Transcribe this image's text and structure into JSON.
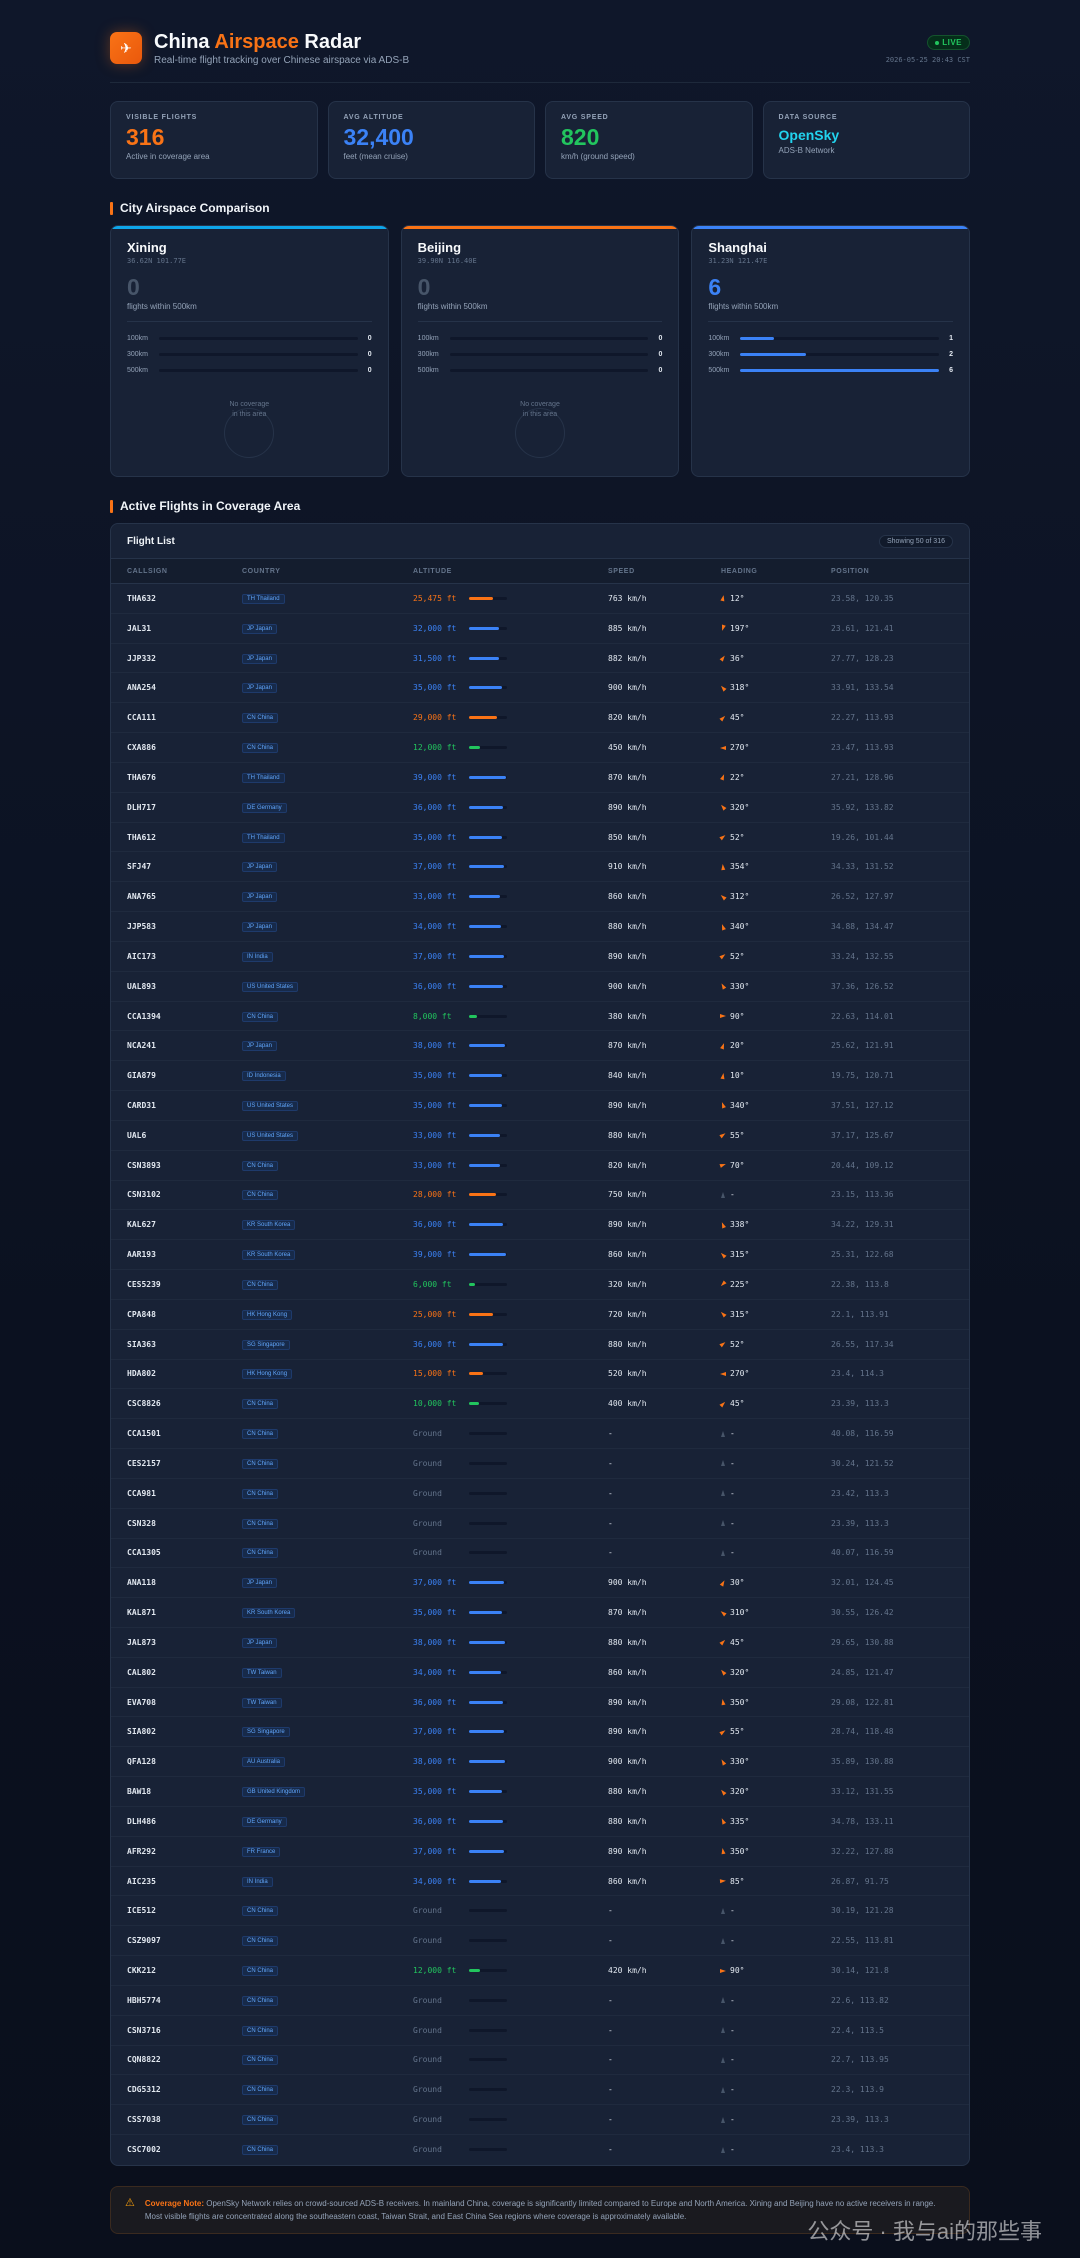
{
  "header": {
    "logo_icon": "plane-icon",
    "title_main": "China ",
    "title_accent": "Airspace",
    "title_tail": " Radar",
    "subtitle": "Real-time flight tracking over Chinese airspace via ADS-B",
    "live": "LIVE",
    "timestamp": "2026-05-25 20:43 CST"
  },
  "stats": [
    {
      "label": "VISIBLE FLIGHTS",
      "value": "316",
      "sub": "Active in coverage area",
      "color": "#f97316"
    },
    {
      "label": "AVG ALTITUDE",
      "value": "32,400",
      "sub": "feet (mean cruise)",
      "color": "#3b82f6"
    },
    {
      "label": "AVG SPEED",
      "value": "820",
      "sub": "km/h (ground speed)",
      "color": "#22c55e"
    },
    {
      "label": "DATA SOURCE",
      "value": "OpenSky",
      "sub": "ADS-B Network",
      "color": "#22d3ee"
    }
  ],
  "sections": {
    "cities": "City Airspace Comparison",
    "flights": "Active Flights in Coverage Area"
  },
  "cities": [
    {
      "name": "Xining",
      "coord": "36.62N 101.77E",
      "count": "0",
      "count_label": "flights within 500km",
      "accent": "#0ea5e9",
      "count_color": "#475569",
      "radii": [
        {
          "label": "100km",
          "value": 0,
          "fill": 0
        },
        {
          "label": "300km",
          "value": 0,
          "fill": 0
        },
        {
          "label": "500km",
          "value": 0,
          "fill": 0
        }
      ],
      "no_coverage": [
        "No coverage",
        "in this area"
      ]
    },
    {
      "name": "Beijing",
      "coord": "39.90N 116.40E",
      "count": "0",
      "count_label": "flights within 500km",
      "accent": "#f97316",
      "count_color": "#475569",
      "radii": [
        {
          "label": "100km",
          "value": 0,
          "fill": 0
        },
        {
          "label": "300km",
          "value": 0,
          "fill": 0
        },
        {
          "label": "500km",
          "value": 0,
          "fill": 0
        }
      ],
      "no_coverage": [
        "No coverage",
        "in this area"
      ]
    },
    {
      "name": "Shanghai",
      "coord": "31.23N 121.47E",
      "count": "6",
      "count_label": "flights within 500km",
      "accent": "#3b82f6",
      "count_color": "#3b82f6",
      "radii": [
        {
          "label": "100km",
          "value": 1,
          "fill": 0.17
        },
        {
          "label": "300km",
          "value": 2,
          "fill": 0.33
        },
        {
          "label": "500km",
          "value": 6,
          "fill": 1
        }
      ],
      "no_coverage": null
    }
  ],
  "table": {
    "title": "Flight List",
    "showing": "Showing 50 of 316",
    "columns": [
      "CALLSIGN",
      "COUNTRY",
      "ALTITUDE",
      "SPEED",
      "HEADING",
      "POSITION"
    ],
    "rows": [
      {
        "cs": "THA632",
        "country": "TH Thailand",
        "alt": "25,475 ft",
        "speed": "763 km/h",
        "heading": "12°",
        "pos": "23.58, 120.35"
      },
      {
        "cs": "JAL31",
        "country": "JP Japan",
        "alt": "32,000 ft",
        "speed": "885 km/h",
        "heading": "197°",
        "pos": "23.61, 121.41"
      },
      {
        "cs": "JJP332",
        "country": "JP Japan",
        "alt": "31,500 ft",
        "speed": "882 km/h",
        "heading": "36°",
        "pos": "27.77, 128.23"
      },
      {
        "cs": "ANA254",
        "country": "JP Japan",
        "alt": "35,000 ft",
        "speed": "900 km/h",
        "heading": "318°",
        "pos": "33.91, 133.54"
      },
      {
        "cs": "CCA111",
        "country": "CN China",
        "alt": "29,000 ft",
        "speed": "820 km/h",
        "heading": "45°",
        "pos": "22.27, 113.93"
      },
      {
        "cs": "CXA886",
        "country": "CN China",
        "alt": "12,000 ft",
        "speed": "450 km/h",
        "heading": "270°",
        "pos": "23.47, 113.93"
      },
      {
        "cs": "THA676",
        "country": "TH Thailand",
        "alt": "39,000 ft",
        "speed": "870 km/h",
        "heading": "22°",
        "pos": "27.21, 128.96"
      },
      {
        "cs": "DLH717",
        "country": "DE Germany",
        "alt": "36,000 ft",
        "speed": "890 km/h",
        "heading": "320°",
        "pos": "35.92, 133.82"
      },
      {
        "cs": "THA612",
        "country": "TH Thailand",
        "alt": "35,000 ft",
        "speed": "850 km/h",
        "heading": "52°",
        "pos": "19.26, 101.44"
      },
      {
        "cs": "SFJ47",
        "country": "JP Japan",
        "alt": "37,000 ft",
        "speed": "910 km/h",
        "heading": "354°",
        "pos": "34.33, 131.52"
      },
      {
        "cs": "ANA765",
        "country": "JP Japan",
        "alt": "33,000 ft",
        "speed": "860 km/h",
        "heading": "312°",
        "pos": "26.52, 127.97"
      },
      {
        "cs": "JJP583",
        "country": "JP Japan",
        "alt": "34,000 ft",
        "speed": "880 km/h",
        "heading": "340°",
        "pos": "34.88, 134.47"
      },
      {
        "cs": "AIC173",
        "country": "IN India",
        "alt": "37,000 ft",
        "speed": "890 km/h",
        "heading": "52°",
        "pos": "33.24, 132.55"
      },
      {
        "cs": "UAL893",
        "country": "US United States",
        "alt": "36,000 ft",
        "speed": "900 km/h",
        "heading": "330°",
        "pos": "37.36, 126.52"
      },
      {
        "cs": "CCA1394",
        "country": "CN China",
        "alt": "8,000 ft",
        "speed": "380 km/h",
        "heading": "90°",
        "pos": "22.63, 114.01"
      },
      {
        "cs": "NCA241",
        "country": "JP Japan",
        "alt": "38,000 ft",
        "speed": "870 km/h",
        "heading": "20°",
        "pos": "25.62, 121.91"
      },
      {
        "cs": "GIA879",
        "country": "ID Indonesia",
        "alt": "35,000 ft",
        "speed": "840 km/h",
        "heading": "10°",
        "pos": "19.75, 120.71"
      },
      {
        "cs": "CARD31",
        "country": "US United States",
        "alt": "35,000 ft",
        "speed": "890 km/h",
        "heading": "340°",
        "pos": "37.51, 127.12"
      },
      {
        "cs": "UAL6",
        "country": "US United States",
        "alt": "33,000 ft",
        "speed": "880 km/h",
        "heading": "55°",
        "pos": "37.17, 125.67"
      },
      {
        "cs": "CSN3893",
        "country": "CN China",
        "alt": "33,000 ft",
        "speed": "820 km/h",
        "heading": "70°",
        "pos": "20.44, 109.12"
      },
      {
        "cs": "CSN3102",
        "country": "CN China",
        "alt": "28,000 ft",
        "speed": "750 km/h",
        "heading": "-",
        "pos": "23.15, 113.36"
      },
      {
        "cs": "KAL627",
        "country": "KR South Korea",
        "alt": "36,000 ft",
        "speed": "890 km/h",
        "heading": "338°",
        "pos": "34.22, 129.31"
      },
      {
        "cs": "AAR193",
        "country": "KR South Korea",
        "alt": "39,000 ft",
        "speed": "860 km/h",
        "heading": "315°",
        "pos": "25.31, 122.68"
      },
      {
        "cs": "CES5239",
        "country": "CN China",
        "alt": "6,000 ft",
        "speed": "320 km/h",
        "heading": "225°",
        "pos": "22.38, 113.8"
      },
      {
        "cs": "CPA848",
        "country": "HK Hong Kong",
        "alt": "25,000 ft",
        "speed": "720 km/h",
        "heading": "315°",
        "pos": "22.1, 113.91"
      },
      {
        "cs": "SIA363",
        "country": "SG Singapore",
        "alt": "36,000 ft",
        "speed": "880 km/h",
        "heading": "52°",
        "pos": "26.55, 117.34"
      },
      {
        "cs": "HDA802",
        "country": "HK Hong Kong",
        "alt": "15,000 ft",
        "speed": "520 km/h",
        "heading": "270°",
        "pos": "23.4, 114.3"
      },
      {
        "cs": "CSC8826",
        "country": "CN China",
        "alt": "10,000 ft",
        "speed": "400 km/h",
        "heading": "45°",
        "pos": "23.39, 113.3"
      },
      {
        "cs": "CCA1501",
        "country": "CN China",
        "alt": "Ground",
        "speed": "-",
        "heading": "-",
        "pos": "40.08, 116.59"
      },
      {
        "cs": "CES2157",
        "country": "CN China",
        "alt": "Ground",
        "speed": "-",
        "heading": "-",
        "pos": "30.24, 121.52"
      },
      {
        "cs": "CCA981",
        "country": "CN China",
        "alt": "Ground",
        "speed": "-",
        "heading": "-",
        "pos": "23.42, 113.3"
      },
      {
        "cs": "CSN328",
        "country": "CN China",
        "alt": "Ground",
        "speed": "-",
        "heading": "-",
        "pos": "23.39, 113.3"
      },
      {
        "cs": "CCA1305",
        "country": "CN China",
        "alt": "Ground",
        "speed": "-",
        "heading": "-",
        "pos": "40.07, 116.59"
      },
      {
        "cs": "ANA118",
        "country": "JP Japan",
        "alt": "37,000 ft",
        "speed": "900 km/h",
        "heading": "30°",
        "pos": "32.01, 124.45"
      },
      {
        "cs": "KAL871",
        "country": "KR South Korea",
        "alt": "35,000 ft",
        "speed": "870 km/h",
        "heading": "310°",
        "pos": "30.55, 126.42"
      },
      {
        "cs": "JAL873",
        "country": "JP Japan",
        "alt": "38,000 ft",
        "speed": "880 km/h",
        "heading": "45°",
        "pos": "29.65, 130.88"
      },
      {
        "cs": "CAL802",
        "country": "TW Taiwan",
        "alt": "34,000 ft",
        "speed": "860 km/h",
        "heading": "320°",
        "pos": "24.85, 121.47"
      },
      {
        "cs": "EVA708",
        "country": "TW Taiwan",
        "alt": "36,000 ft",
        "speed": "890 km/h",
        "heading": "350°",
        "pos": "29.08, 122.81"
      },
      {
        "cs": "SIA802",
        "country": "SG Singapore",
        "alt": "37,000 ft",
        "speed": "890 km/h",
        "heading": "55°",
        "pos": "28.74, 118.48"
      },
      {
        "cs": "QFA128",
        "country": "AU Australia",
        "alt": "38,000 ft",
        "speed": "900 km/h",
        "heading": "330°",
        "pos": "35.89, 130.88"
      },
      {
        "cs": "BAW18",
        "country": "GB United Kingdom",
        "alt": "35,000 ft",
        "speed": "880 km/h",
        "heading": "320°",
        "pos": "33.12, 131.55"
      },
      {
        "cs": "DLH486",
        "country": "DE Germany",
        "alt": "36,000 ft",
        "speed": "880 km/h",
        "heading": "335°",
        "pos": "34.78, 133.11"
      },
      {
        "cs": "AFR292",
        "country": "FR France",
        "alt": "37,000 ft",
        "speed": "890 km/h",
        "heading": "350°",
        "pos": "32.22, 127.88"
      },
      {
        "cs": "AIC235",
        "country": "IN India",
        "alt": "34,000 ft",
        "speed": "860 km/h",
        "heading": "85°",
        "pos": "26.87, 91.75"
      },
      {
        "cs": "ICE512",
        "country": "CN China",
        "alt": "Ground",
        "speed": "-",
        "heading": "-",
        "pos": "30.19, 121.28"
      },
      {
        "cs": "CSZ9097",
        "country": "CN China",
        "alt": "Ground",
        "speed": "-",
        "heading": "-",
        "pos": "22.55, 113.81"
      },
      {
        "cs": "CKK212",
        "country": "CN China",
        "alt": "12,000 ft",
        "speed": "420 km/h",
        "heading": "90°",
        "pos": "30.14, 121.8"
      },
      {
        "cs": "HBH5774",
        "country": "CN China",
        "alt": "Ground",
        "speed": "-",
        "heading": "-",
        "pos": "22.6, 113.82"
      },
      {
        "cs": "CSN3716",
        "country": "CN China",
        "alt": "Ground",
        "speed": "-",
        "heading": "-",
        "pos": "22.4, 113.5"
      },
      {
        "cs": "CQN8822",
        "country": "CN China",
        "alt": "Ground",
        "speed": "-",
        "heading": "-",
        "pos": "22.7, 113.95"
      },
      {
        "cs": "CDG5312",
        "country": "CN China",
        "alt": "Ground",
        "speed": "-",
        "heading": "-",
        "pos": "22.3, 113.9"
      },
      {
        "cs": "CSS7038",
        "country": "CN China",
        "alt": "Ground",
        "speed": "-",
        "heading": "-",
        "pos": "23.39, 113.3"
      },
      {
        "cs": "CSC7002",
        "country": "CN China",
        "alt": "Ground",
        "speed": "-",
        "heading": "-",
        "pos": "23.4, 113.3"
      }
    ]
  },
  "note": {
    "icon": "warning-icon",
    "label": "Coverage Note:",
    "text": "OpenSky Network relies on crowd-sourced ADS-B receivers. In mainland China, coverage is significantly limited compared to Europe and North America. Xining and Beijing have no active receivers in range. Most visible flights are concentrated along the southeastern coast, Taiwan Strait, and East China Sea regions where coverage is approximately available."
  },
  "watermark": "公众号 · 我与ai的那些事",
  "colors": {
    "high": "#3b82f6",
    "mid": "#f97316",
    "low": "#22c55e",
    "ground": "#64748b"
  }
}
